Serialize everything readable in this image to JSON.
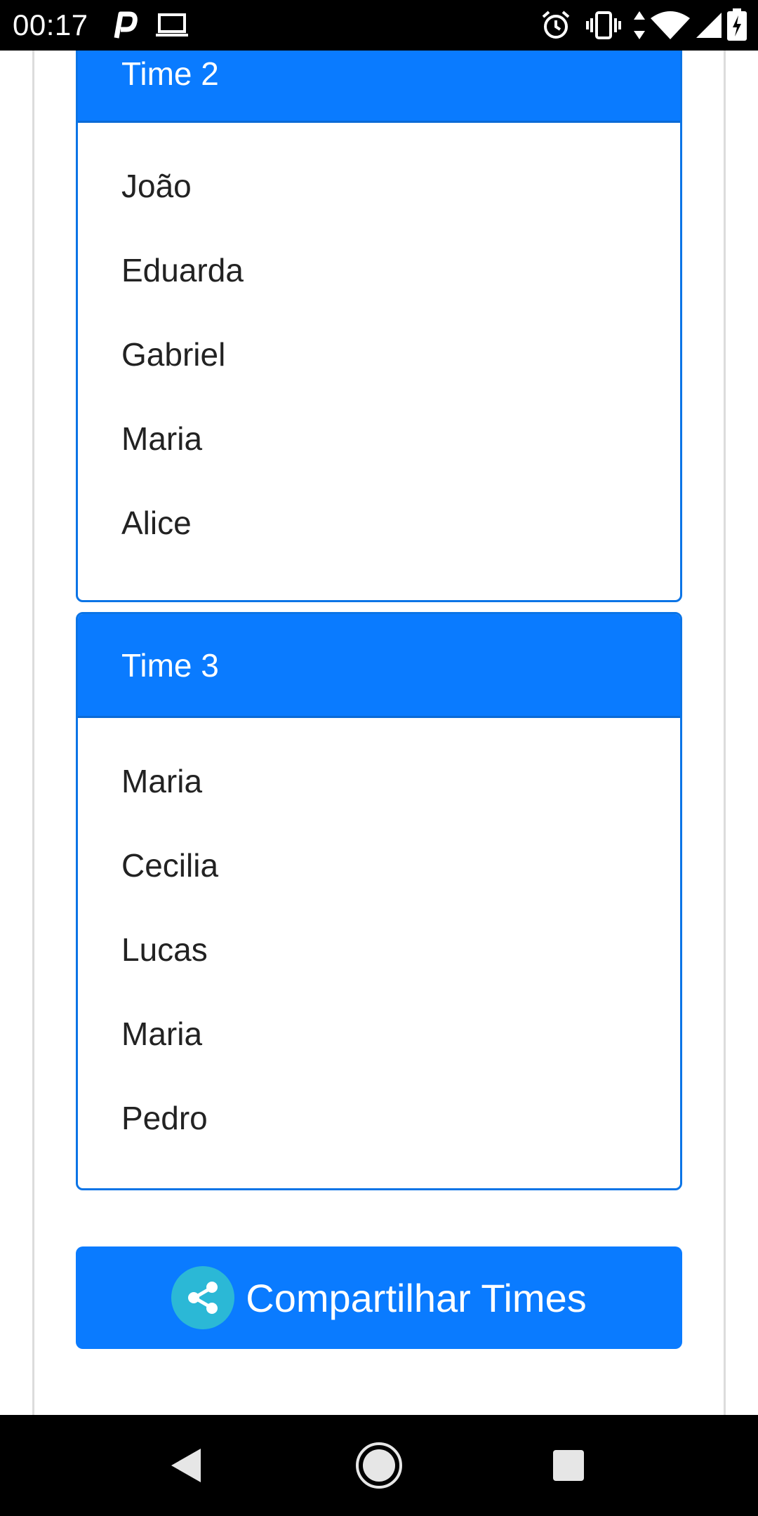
{
  "status_bar": {
    "time": "00:17",
    "icons": [
      "p-notification-icon",
      "laptop-icon",
      "alarm-icon",
      "vibrate-icon",
      "data-arrows-icon",
      "wifi-icon",
      "signal-icon",
      "battery-icon"
    ]
  },
  "teams": [
    {
      "title": "Time 2",
      "players": [
        "João",
        "Eduarda",
        "Gabriel",
        "Maria",
        "Alice"
      ]
    },
    {
      "title": "Time 3",
      "players": [
        "Maria",
        "Cecilia",
        "Lucas",
        "Maria",
        "Pedro"
      ]
    }
  ],
  "share_button": {
    "label": "Compartilhar Times",
    "icon": "share-icon"
  },
  "nav_bar": {
    "icons": [
      "back-icon",
      "home-icon",
      "recents-icon"
    ]
  },
  "colors": {
    "primary": "#0a7bff",
    "share_icon_bg": "#2bb8d6",
    "text": "#222222"
  }
}
